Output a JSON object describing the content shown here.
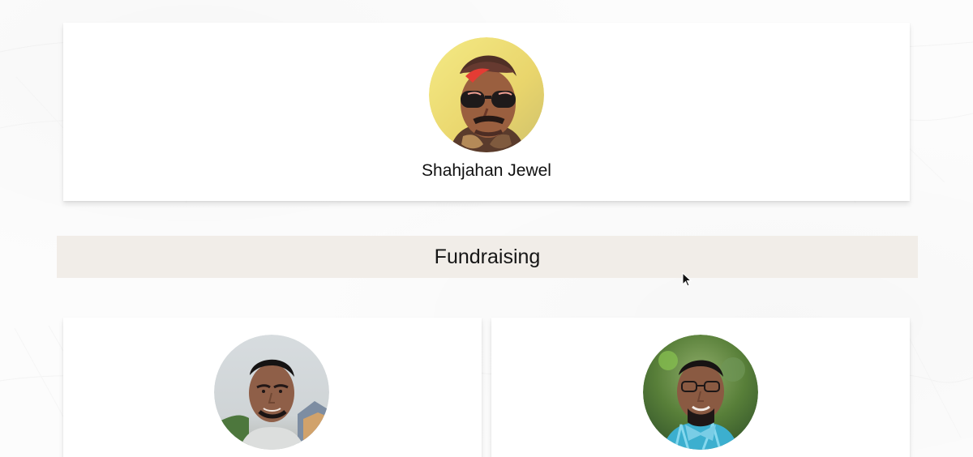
{
  "featured_member": {
    "name": "Shahjahan Jewel",
    "avatar_icon": "member-avatar-icon"
  },
  "section": {
    "title": "Fundraising"
  },
  "team_members": [
    {
      "avatar_icon": "member-avatar-icon"
    },
    {
      "avatar_icon": "member-avatar-icon"
    }
  ],
  "colors": {
    "section_background": "#f1ede8",
    "text": "#111111",
    "card_background": "#ffffff"
  }
}
